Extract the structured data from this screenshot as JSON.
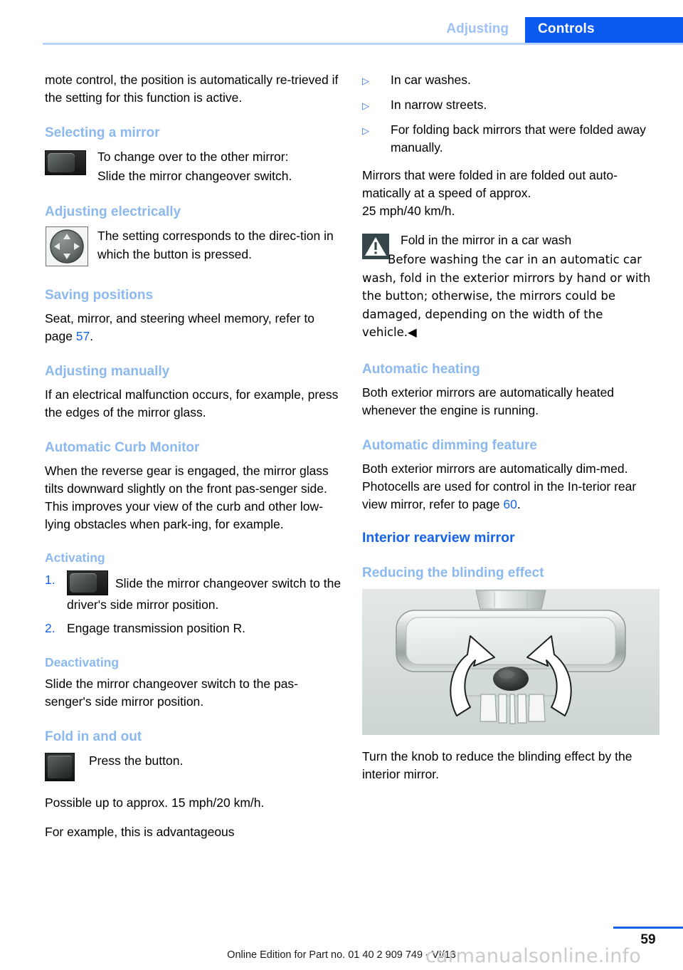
{
  "header": {
    "section_label": "Adjusting",
    "chapter_label": "Controls",
    "accent_blue": "#0a5af0",
    "muted_blue": "#9ec1f5",
    "rule_color": "#b9d4fb"
  },
  "left_column": {
    "intro_paragraph": "mote control, the position is automatically re-trieved if the setting for this function is active.",
    "selecting_a_mirror": {
      "heading": "Selecting a mirror",
      "icon": "mirror-changeover-switch-icon",
      "line1": "To change over to the other mirror:",
      "line2": "Slide the mirror changeover switch."
    },
    "adjusting_electrically": {
      "heading": "Adjusting electrically",
      "icon": "directional-pad-icon",
      "text": "The setting corresponds to the direc-tion in which the button is pressed."
    },
    "saving_positions": {
      "heading": "Saving positions",
      "text_before": "Seat, mirror, and steering wheel memory, refer to page ",
      "page_ref": "57",
      "text_after": "."
    },
    "adjusting_manually": {
      "heading": "Adjusting manually",
      "text": "If an electrical malfunction occurs, for example, press the edges of the mirror glass."
    },
    "automatic_curb_monitor": {
      "heading": "Automatic Curb Monitor",
      "text": "When the reverse gear is engaged, the mirror glass tilts downward slightly on the front pas-senger side. This improves your view of the curb and other low-lying obstacles when park-ing, for example."
    },
    "activating": {
      "heading": "Activating",
      "steps": [
        {
          "number": "1.",
          "icon": "mirror-changeover-switch-icon",
          "text": "Slide the mirror changeover switch to the driver's side mirror position."
        },
        {
          "number": "2.",
          "icon": "",
          "text": "Engage transmission position R."
        }
      ]
    },
    "deactivating": {
      "heading": "Deactivating",
      "text": "Slide the mirror changeover switch to the pas-senger's side mirror position."
    },
    "fold_in_and_out": {
      "heading": "Fold in and out",
      "icon": "press-button-icon",
      "icon_text": "Press the button.",
      "paragraph1": "Possible up to approx. 15 mph/20 km/h.",
      "paragraph2": "For example, this is advantageous"
    }
  },
  "right_column": {
    "bullets": [
      "In car washes.",
      "In narrow streets.",
      "For folding back mirrors that were folded away manually."
    ],
    "bullet_marker": "▷",
    "after_bullets_paragraph": "Mirrors that were folded in are folded out auto-matically at a speed of approx.\n25 mph/40 km/h.",
    "warning": {
      "icon": "warning-triangle-icon",
      "title": "Fold in the mirror in a car wash",
      "body": "Before washing the car in an automatic car wash, fold in the exterior mirrors by hand or with the button; otherwise, the mirrors could be damaged, depending on the width of the vehicle.◀"
    },
    "automatic_heating": {
      "heading": "Automatic heating",
      "text": "Both exterior mirrors are automatically heated whenever the engine is running."
    },
    "automatic_dimming": {
      "heading": "Automatic dimming feature",
      "text_before": "Both exterior mirrors are automatically dim-med. Photocells are used for control in the In-terior rear view mirror, refer to page ",
      "page_ref": "60",
      "text_after": "."
    },
    "interior_rearview_mirror": {
      "heading": "Interior rearview mirror",
      "subheading": "Reducing the blinding effect",
      "figure_alt": "interior-rearview-mirror-illustration",
      "caption": "Turn the knob to reduce the blinding effect by the interior mirror."
    }
  },
  "footer": {
    "page_number": "59",
    "edition_text": "Online Edition for Part no. 01 40 2 909 749 - VI/13",
    "watermark": "carmanualsonline.info"
  }
}
